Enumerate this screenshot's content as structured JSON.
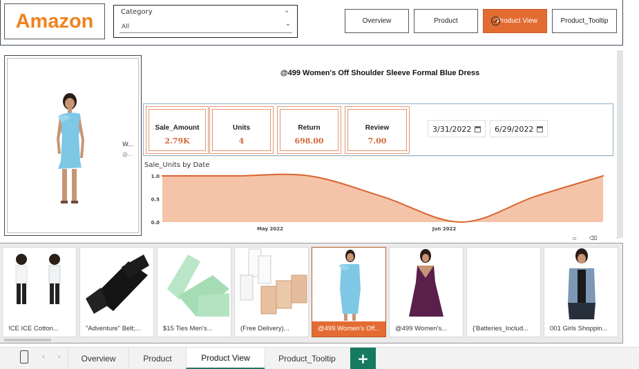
{
  "header": {
    "logo_text": "Amazon",
    "category_slicer": {
      "title": "Category",
      "selected": "All"
    },
    "nav_buttons": [
      "Overview",
      "Product",
      "Product View",
      "Product_Tooltip"
    ],
    "active_nav": "Product View"
  },
  "product_card": {
    "text_line1": "W...",
    "text_line2": "@..."
  },
  "product_title": "@499 Women's Off Shoulder Sleeve Formal Blue Dress",
  "kpis": [
    {
      "label": "Sale_Amount",
      "value": "2.79K"
    },
    {
      "label": "Units",
      "value": "4"
    },
    {
      "label": "Return",
      "value": "698.00"
    },
    {
      "label": "Review",
      "value": "7.00"
    }
  ],
  "date_range": {
    "start": "3/31/2022",
    "end": "6/29/2022"
  },
  "chart_data": {
    "type": "area",
    "title": "Sale_Units by Date",
    "x_ticks": [
      "May 2022",
      "Jun 2022"
    ],
    "y_ticks": [
      "0.0",
      "0.5",
      "1.0"
    ],
    "ylim": [
      0,
      1
    ],
    "x": [
      "2022-03-31",
      "2022-04-15",
      "2022-04-30",
      "2022-05-15",
      "2022-05-31",
      "2022-06-15",
      "2022-06-29"
    ],
    "values": [
      1.0,
      1.0,
      1.0,
      0.55,
      0.0,
      0.55,
      1.0
    ],
    "color": "#e36c33"
  },
  "gallery": {
    "items": [
      {
        "label": "!CE ICE Cotton...",
        "icon": "kids-clothes-image"
      },
      {
        "label": "\"Adventure\" Belt;...",
        "icon": "belt-image"
      },
      {
        "label": "$15 Ties Men's...",
        "icon": "tie-image"
      },
      {
        "label": "(Free Delivery)...",
        "icon": "bra-extender-image"
      },
      {
        "label": "@499 Women's Off...",
        "icon": "blue-dress-image"
      },
      {
        "label": "@499 Women's...",
        "icon": "purple-dress-image"
      },
      {
        "label": "{'Batteries_Includ...",
        "icon": "blank-image"
      },
      {
        "label": "001 Girls Shoppin...",
        "icon": "denim-vest-image"
      }
    ],
    "selected_index": 4
  },
  "tabs": {
    "pages": [
      "Overview",
      "Product",
      "Product View",
      "Product_Tooltip"
    ],
    "active": "Product View",
    "add_label": "+"
  },
  "colors": {
    "accent": "#e36c33",
    "brand_orange": "#f0821e",
    "tab_green": "#157a5f"
  }
}
